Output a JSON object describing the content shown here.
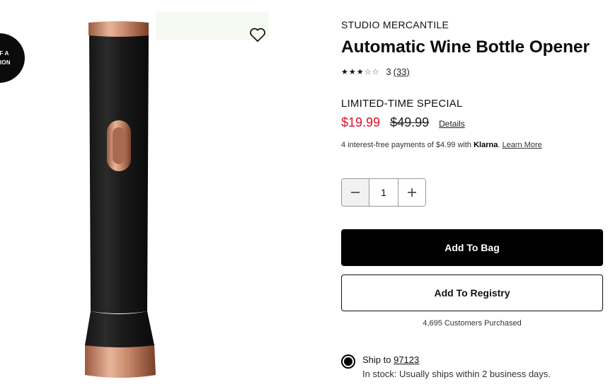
{
  "badge": {
    "line1": "T OF A",
    "line2": "ECTION"
  },
  "product": {
    "brand": "STUDIO MERCANTILE",
    "title": "Automatic Wine Bottle Opener",
    "rating": {
      "stars": 3,
      "max_stars": 5,
      "value": "3",
      "count_link": "(33)"
    },
    "promo_label": "LIMITED-TIME SPECIAL",
    "sale_price": "$19.99",
    "original_price": "$49.99",
    "details_link": "Details",
    "klarna": {
      "prefix": "4 interest-free payments of $4.99 with ",
      "brand": "Klarna",
      "suffix": ". ",
      "learn_more": "Learn More"
    }
  },
  "quantity": {
    "value": "1",
    "minus_icon": "minus-icon",
    "plus_icon": "plus-icon"
  },
  "actions": {
    "add_to_bag": "Add To Bag",
    "add_to_registry": "Add To Registry",
    "purchased": "4,695 Customers Purchased"
  },
  "shipping": {
    "prefix": "Ship to ",
    "zip": "97123",
    "stock": "In stock: Usually ships within 2 business days."
  },
  "colors": {
    "sale": "#e0102b",
    "primary_button": "#000000",
    "copper": "#c98a6c"
  },
  "icons": {
    "wishlist": "heart-outline-icon",
    "radio": "radio-selected-icon"
  }
}
